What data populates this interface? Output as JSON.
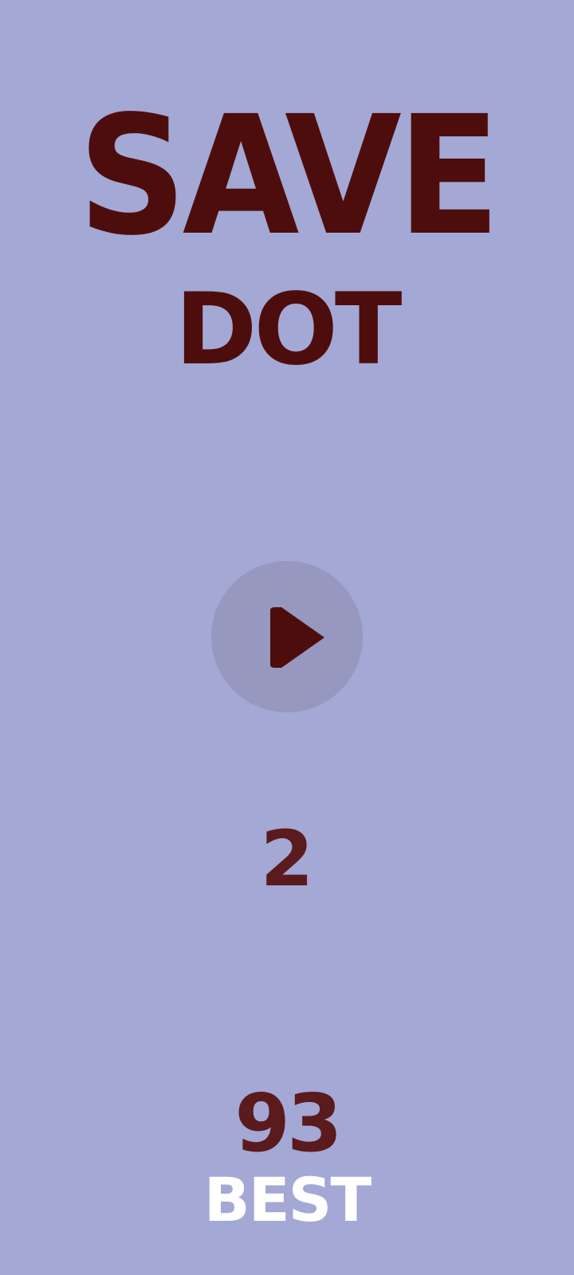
{
  "title": {
    "line1": "SAVE",
    "line2": "DOT"
  },
  "play_button": {
    "icon": "play-icon"
  },
  "level": "2",
  "best": {
    "score": "93",
    "label": "BEST"
  },
  "colors": {
    "background": "#a3a8d5",
    "title": "#4e0d0d",
    "score": "#5b1a1c",
    "best_label": "#ffffff",
    "button_bg": "#9698bf"
  }
}
